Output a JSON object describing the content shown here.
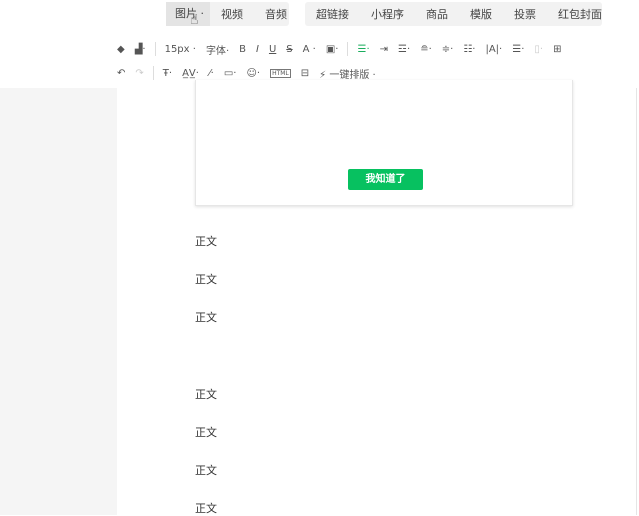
{
  "insert_menu": {
    "group1": [
      "图片",
      "视频",
      "音频"
    ],
    "group2": [
      "超链接",
      "小程序",
      "商品",
      "模版",
      "投票",
      "红包封面"
    ],
    "dropdown_marker": "·"
  },
  "toolbar": {
    "font_size": "15px",
    "font_family": "字体",
    "bold": "B",
    "italic": "I",
    "underline": "U",
    "strike": "S",
    "font_color": "A",
    "one_click_layout": "一键排版",
    "html": "HTML",
    "accent": "#1aad5d"
  },
  "dialog": {
    "button_label": "我知道了",
    "button_color": "#07c160"
  },
  "paragraphs": [
    "正文",
    "正文",
    "正文",
    "正文",
    "正文",
    "正文",
    "正文"
  ]
}
